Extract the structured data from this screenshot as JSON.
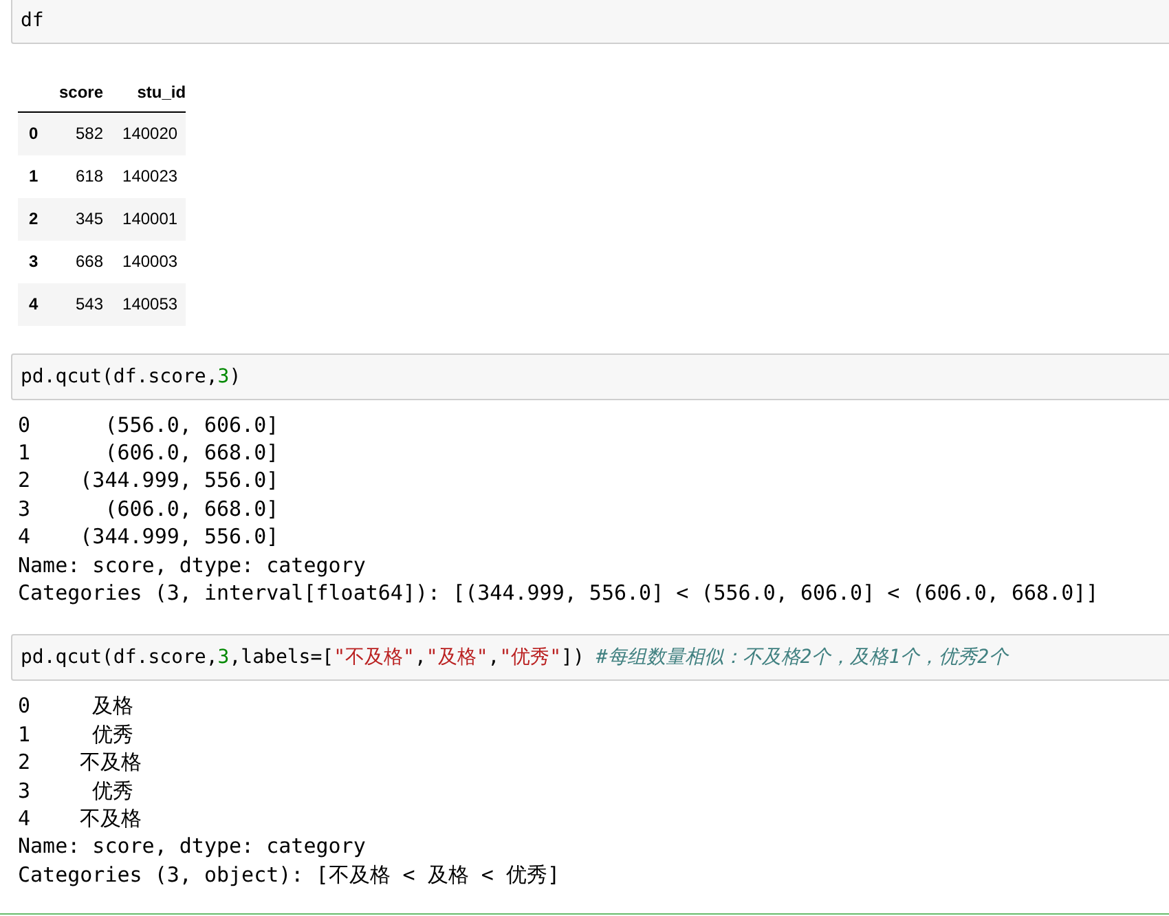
{
  "cells": [
    {
      "input": [
        [
          {
            "kind": "plain",
            "text": "df"
          }
        ]
      ],
      "output": {
        "kind": "table",
        "columns": [
          "",
          "score",
          "stu_id"
        ],
        "rows": [
          [
            "0",
            "582",
            "140020"
          ],
          [
            "1",
            "618",
            "140023"
          ],
          [
            "2",
            "345",
            "140001"
          ],
          [
            "3",
            "668",
            "140003"
          ],
          [
            "4",
            "543",
            "140053"
          ]
        ]
      }
    },
    {
      "input": [
        [
          {
            "kind": "plain",
            "text": "pd.qcut(df.score,"
          },
          {
            "kind": "number",
            "text": "3"
          },
          {
            "kind": "plain",
            "text": ")"
          }
        ]
      ],
      "output": {
        "kind": "text",
        "lines": [
          "0      (556.0, 606.0]",
          "1      (606.0, 668.0]",
          "2    (344.999, 556.0]",
          "3      (606.0, 668.0]",
          "4    (344.999, 556.0]",
          "Name: score, dtype: category",
          "Categories (3, interval[float64]): [(344.999, 556.0] < (556.0, 606.0] < (606.0, 668.0]]"
        ]
      }
    },
    {
      "input": [
        [
          {
            "kind": "plain",
            "text": "pd.qcut(df.score,"
          },
          {
            "kind": "number",
            "text": "3"
          },
          {
            "kind": "plain",
            "text": ",labels=["
          },
          {
            "kind": "string",
            "text": "\"不及格\""
          },
          {
            "kind": "plain",
            "text": ","
          },
          {
            "kind": "string",
            "text": "\"及格\""
          },
          {
            "kind": "plain",
            "text": ","
          },
          {
            "kind": "string",
            "text": "\"优秀\""
          },
          {
            "kind": "plain",
            "text": "]) "
          },
          {
            "kind": "comment",
            "text": "#每组数量相似：不及格2个，及格1个，优秀2个"
          }
        ]
      ],
      "output": {
        "kind": "text",
        "lines": [
          "0     及格",
          "1     优秀",
          "2    不及格",
          "3     优秀",
          "4    不及格",
          "Name: score, dtype: category",
          "Categories (3, object): [不及格 < 及格 < 优秀]"
        ]
      }
    }
  ]
}
